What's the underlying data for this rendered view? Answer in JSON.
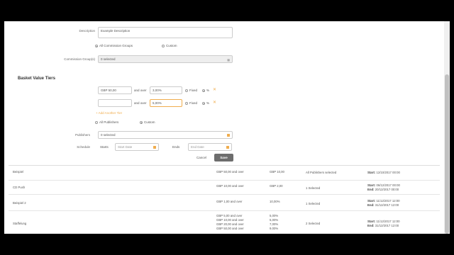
{
  "form": {
    "description_label": "Description",
    "description_value": "Example Description",
    "scope_options": [
      "All Commission Groups",
      "Custom"
    ],
    "commission_groups_label": "Commission Group(s)",
    "commission_groups_value": "0 selected"
  },
  "tiers": {
    "heading": "Basket Value Tiers",
    "rows": [
      {
        "amount": "GBP 50,00",
        "connector": "and over",
        "rate": "3,00%"
      },
      {
        "amount": "",
        "connector": "and over",
        "rate": "5,00%"
      }
    ],
    "fixed_label": "Fixed",
    "percent_label": "%",
    "add_tier": "+ Add Another Tier"
  },
  "publishers": {
    "options": [
      "All Publishers",
      "Custom"
    ],
    "label": "Publishers",
    "value": "0 selected"
  },
  "schedule": {
    "label": "Schedule",
    "starts_label": "Starts",
    "start_placeholder": "Start Date",
    "ends_label": "Ends",
    "end_placeholder": "End Date"
  },
  "actions": {
    "cancel": "Cancel",
    "save": "Save"
  },
  "table": {
    "rows": [
      {
        "name": "Beispiel",
        "tiers": [
          "GBP 50,00 and over"
        ],
        "rates": [
          "GBP 10,00"
        ],
        "publishers": "All Publishers selected",
        "start": "12/10/2017 00:00",
        "end": ""
      },
      {
        "name": "CD Push",
        "tiers": [
          "GBP 10,00 and over"
        ],
        "rates": [
          "GBP 2,00"
        ],
        "publishers": "1 Selected",
        "start": "06/12/2017 00:00",
        "end": "20/12/2017 00:00"
      },
      {
        "name": "Beispiel 2",
        "tiers": [
          "GBP 1,00 and over"
        ],
        "rates": [
          "10,00%"
        ],
        "publishers": "1 Selected",
        "start": "11/12/2017 12:00",
        "end": "31/12/2017 12:00"
      },
      {
        "name": "Staffelung",
        "tiers": [
          "GBP 5,00 and over",
          "GBP 10,00 and over",
          "GBP 20,00 and over",
          "GBP 50,00 and over"
        ],
        "rates": [
          "5,00%",
          "5,00%",
          "7,00%",
          "9,00%"
        ],
        "publishers": "2 Selected",
        "start": "11/12/2017 12:00",
        "end": "31/12/2017 12:00"
      }
    ],
    "start_prefix": "Start:",
    "end_prefix": "End:"
  },
  "icons": [
    "calendar-icon",
    "remove-icon",
    "list-icon"
  ],
  "colors": {
    "accent": "#f0ad4e",
    "save": "#6d6d6d"
  }
}
